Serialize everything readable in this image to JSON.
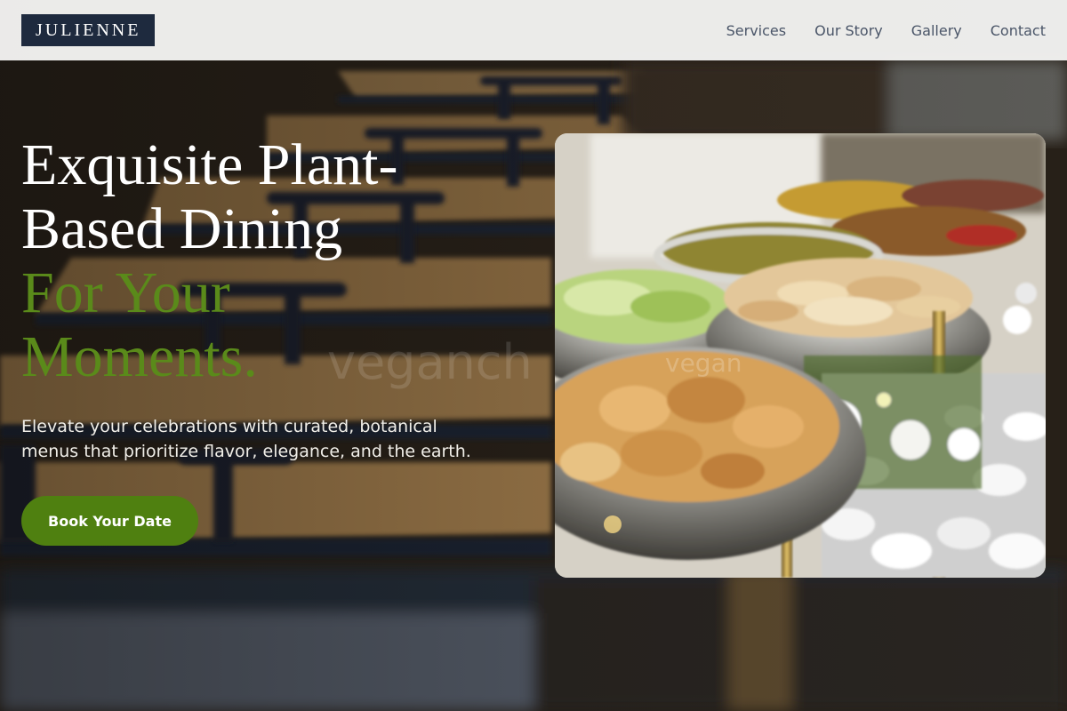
{
  "brand": {
    "logo_text": "JULIENNE",
    "logo_bg_color": "#1e2a3e"
  },
  "nav": {
    "links": [
      {
        "label": "Services"
      },
      {
        "label": "Our Story"
      },
      {
        "label": "Gallery"
      },
      {
        "label": "Contact"
      }
    ]
  },
  "hero": {
    "headline_line1": "Exquisite Plant-",
    "headline_line2": "Based Dining",
    "headline_accent_line1": "For Your",
    "headline_accent_line2": "Moments.",
    "accent_color": "#5a8a1a",
    "subtext": "Elevate your celebrations with curated, botanical menus that prioritize flavor, elegance, and the earth.",
    "cta_label": "Book Your Date",
    "cta_color": "#4f8010",
    "watermark": "veganch",
    "watermark_overlay": "vegan"
  },
  "images": {
    "background": "blurred-restaurant-tables-image",
    "food_card": "vegan-buffet-chafing-dishes-image"
  }
}
